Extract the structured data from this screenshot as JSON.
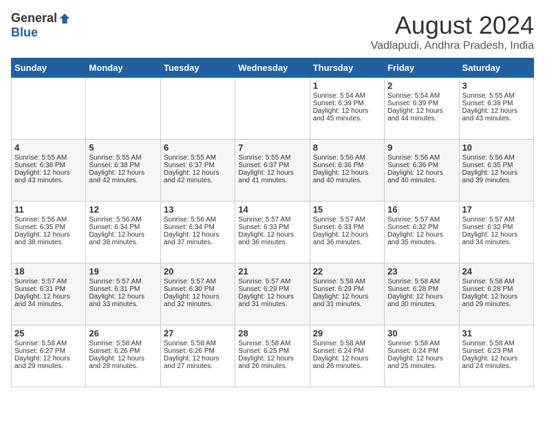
{
  "header": {
    "logo_general": "General",
    "logo_blue": "Blue",
    "month_year": "August 2024",
    "location": "Vadlapudi, Andhra Pradesh, India"
  },
  "weekdays": [
    "Sunday",
    "Monday",
    "Tuesday",
    "Wednesday",
    "Thursday",
    "Friday",
    "Saturday"
  ],
  "weeks": [
    [
      {
        "day": "",
        "info": ""
      },
      {
        "day": "",
        "info": ""
      },
      {
        "day": "",
        "info": ""
      },
      {
        "day": "",
        "info": ""
      },
      {
        "day": "1",
        "info": "Sunrise: 5:54 AM\nSunset: 6:39 PM\nDaylight: 12 hours\nand 45 minutes."
      },
      {
        "day": "2",
        "info": "Sunrise: 5:54 AM\nSunset: 6:39 PM\nDaylight: 12 hours\nand 44 minutes."
      },
      {
        "day": "3",
        "info": "Sunrise: 5:55 AM\nSunset: 6:38 PM\nDaylight: 12 hours\nand 43 minutes."
      }
    ],
    [
      {
        "day": "4",
        "info": "Sunrise: 5:55 AM\nSunset: 6:38 PM\nDaylight: 12 hours\nand 43 minutes."
      },
      {
        "day": "5",
        "info": "Sunrise: 5:55 AM\nSunset: 6:38 PM\nDaylight: 12 hours\nand 42 minutes."
      },
      {
        "day": "6",
        "info": "Sunrise: 5:55 AM\nSunset: 6:37 PM\nDaylight: 12 hours\nand 42 minutes."
      },
      {
        "day": "7",
        "info": "Sunrise: 5:55 AM\nSunset: 6:37 PM\nDaylight: 12 hours\nand 41 minutes."
      },
      {
        "day": "8",
        "info": "Sunrise: 5:56 AM\nSunset: 6:36 PM\nDaylight: 12 hours\nand 40 minutes."
      },
      {
        "day": "9",
        "info": "Sunrise: 5:56 AM\nSunset: 6:36 PM\nDaylight: 12 hours\nand 40 minutes."
      },
      {
        "day": "10",
        "info": "Sunrise: 5:56 AM\nSunset: 6:35 PM\nDaylight: 12 hours\nand 39 minutes."
      }
    ],
    [
      {
        "day": "11",
        "info": "Sunrise: 5:56 AM\nSunset: 6:35 PM\nDaylight: 12 hours\nand 38 minutes."
      },
      {
        "day": "12",
        "info": "Sunrise: 5:56 AM\nSunset: 6:34 PM\nDaylight: 12 hours\nand 38 minutes."
      },
      {
        "day": "13",
        "info": "Sunrise: 5:56 AM\nSunset: 6:34 PM\nDaylight: 12 hours\nand 37 minutes."
      },
      {
        "day": "14",
        "info": "Sunrise: 5:57 AM\nSunset: 6:33 PM\nDaylight: 12 hours\nand 36 minutes."
      },
      {
        "day": "15",
        "info": "Sunrise: 5:57 AM\nSunset: 6:33 PM\nDaylight: 12 hours\nand 36 minutes."
      },
      {
        "day": "16",
        "info": "Sunrise: 5:57 AM\nSunset: 6:32 PM\nDaylight: 12 hours\nand 35 minutes."
      },
      {
        "day": "17",
        "info": "Sunrise: 5:57 AM\nSunset: 6:32 PM\nDaylight: 12 hours\nand 34 minutes."
      }
    ],
    [
      {
        "day": "18",
        "info": "Sunrise: 5:57 AM\nSunset: 6:31 PM\nDaylight: 12 hours\nand 34 minutes."
      },
      {
        "day": "19",
        "info": "Sunrise: 5:57 AM\nSunset: 6:31 PM\nDaylight: 12 hours\nand 33 minutes."
      },
      {
        "day": "20",
        "info": "Sunrise: 5:57 AM\nSunset: 6:30 PM\nDaylight: 12 hours\nand 32 minutes."
      },
      {
        "day": "21",
        "info": "Sunrise: 5:57 AM\nSunset: 6:29 PM\nDaylight: 12 hours\nand 31 minutes."
      },
      {
        "day": "22",
        "info": "Sunrise: 5:58 AM\nSunset: 6:29 PM\nDaylight: 12 hours\nand 31 minutes."
      },
      {
        "day": "23",
        "info": "Sunrise: 5:58 AM\nSunset: 6:28 PM\nDaylight: 12 hours\nand 30 minutes."
      },
      {
        "day": "24",
        "info": "Sunrise: 5:58 AM\nSunset: 6:28 PM\nDaylight: 12 hours\nand 29 minutes."
      }
    ],
    [
      {
        "day": "25",
        "info": "Sunrise: 5:58 AM\nSunset: 6:27 PM\nDaylight: 12 hours\nand 29 minutes."
      },
      {
        "day": "26",
        "info": "Sunrise: 5:58 AM\nSunset: 6:26 PM\nDaylight: 12 hours\nand 28 minutes."
      },
      {
        "day": "27",
        "info": "Sunrise: 5:58 AM\nSunset: 6:26 PM\nDaylight: 12 hours\nand 27 minutes."
      },
      {
        "day": "28",
        "info": "Sunrise: 5:58 AM\nSunset: 6:25 PM\nDaylight: 12 hours\nand 26 minutes."
      },
      {
        "day": "29",
        "info": "Sunrise: 5:58 AM\nSunset: 6:24 PM\nDaylight: 12 hours\nand 26 minutes."
      },
      {
        "day": "30",
        "info": "Sunrise: 5:58 AM\nSunset: 6:24 PM\nDaylight: 12 hours\nand 25 minutes."
      },
      {
        "day": "31",
        "info": "Sunrise: 5:58 AM\nSunset: 6:23 PM\nDaylight: 12 hours\nand 24 minutes."
      }
    ]
  ]
}
